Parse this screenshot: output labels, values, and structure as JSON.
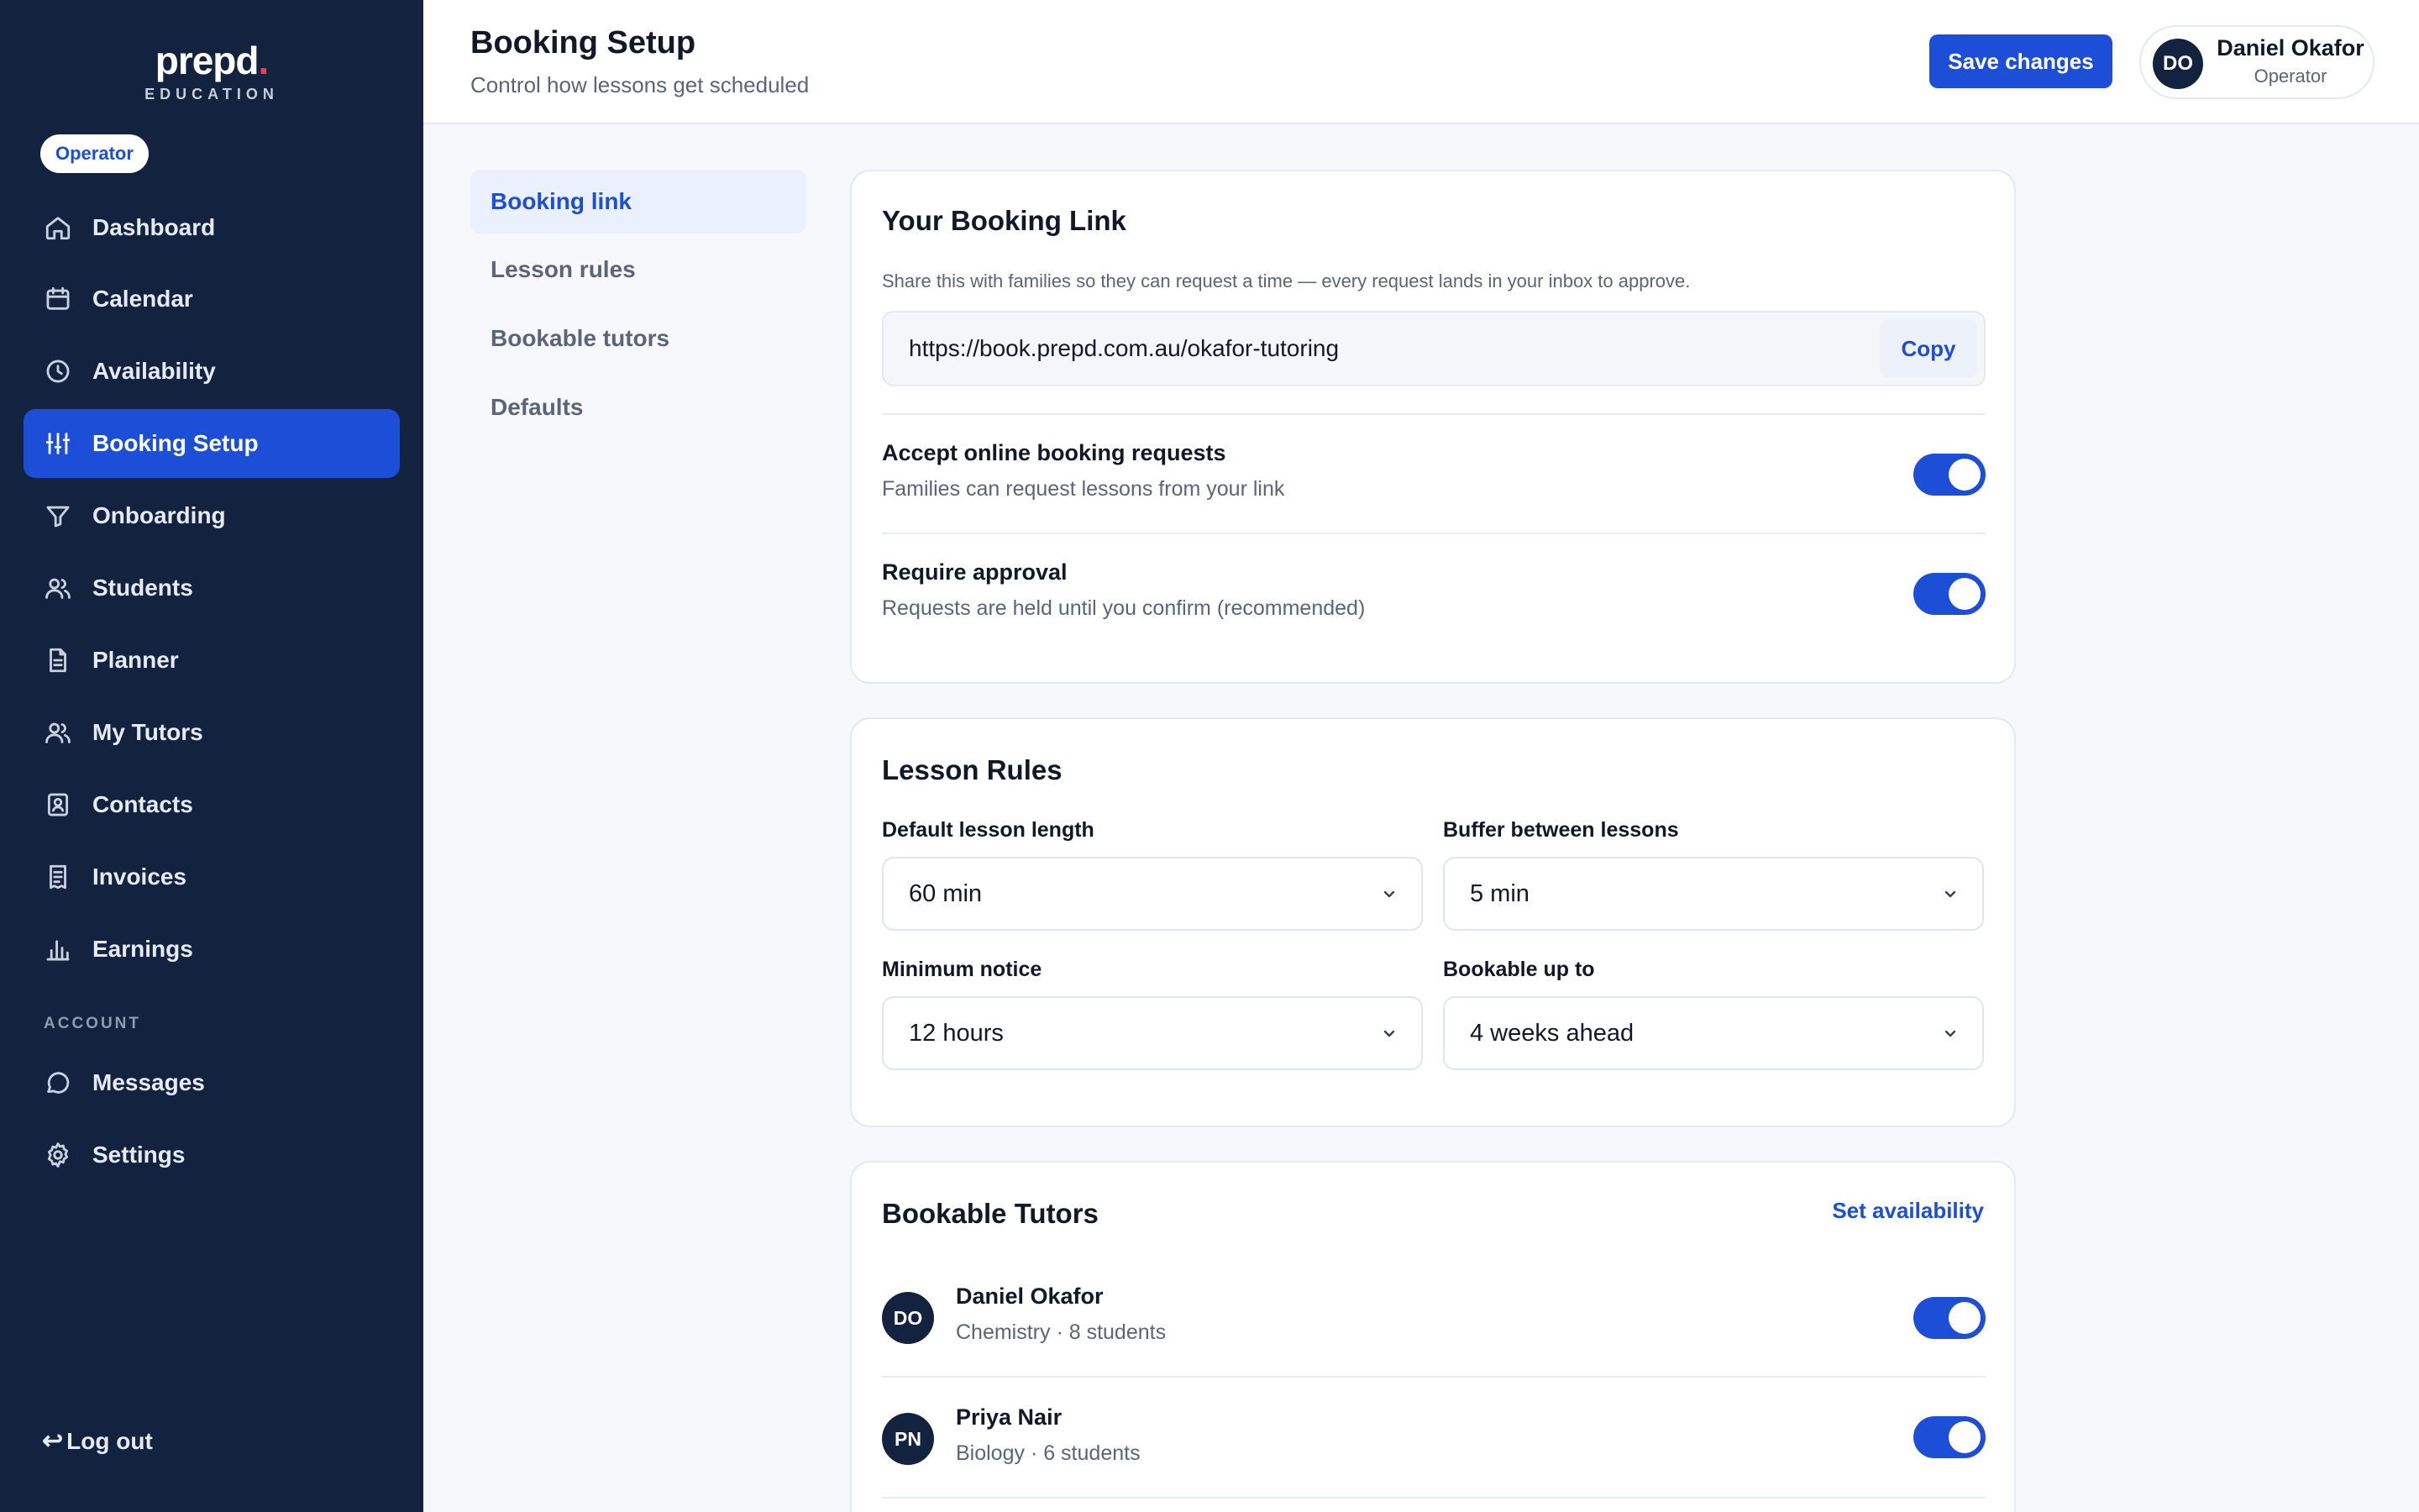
{
  "brand": {
    "name": "prepd",
    "dot": ".",
    "subtitle": "EDUCATION"
  },
  "role_badge": "Operator",
  "nav": {
    "items": [
      {
        "label": "Dashboard",
        "icon": "home-icon"
      },
      {
        "label": "Calendar",
        "icon": "calendar-icon"
      },
      {
        "label": "Availability",
        "icon": "clock-icon"
      },
      {
        "label": "Booking Setup",
        "icon": "sliders-icon",
        "active": true
      },
      {
        "label": "Onboarding",
        "icon": "filter-icon"
      },
      {
        "label": "Students",
        "icon": "users-icon"
      },
      {
        "label": "Planner",
        "icon": "document-icon"
      },
      {
        "label": "My Tutors",
        "icon": "users-icon"
      },
      {
        "label": "Contacts",
        "icon": "contact-card-icon"
      },
      {
        "label": "Invoices",
        "icon": "receipt-icon"
      },
      {
        "label": "Earnings",
        "icon": "bar-chart-icon"
      }
    ],
    "account_heading": "ACCOUNT",
    "account_items": [
      {
        "label": "Messages",
        "icon": "chat-bubble-icon"
      },
      {
        "label": "Settings",
        "icon": "gear-icon"
      }
    ],
    "logout_label": "Log out",
    "logout_icon": "↩"
  },
  "header": {
    "title": "Booking Setup",
    "subtitle": "Control how lessons get scheduled",
    "save_label": "Save changes",
    "user": {
      "initials": "DO",
      "name": "Daniel Okafor",
      "role": "Operator"
    }
  },
  "subnav": [
    {
      "label": "Booking link",
      "active": true
    },
    {
      "label": "Lesson rules"
    },
    {
      "label": "Bookable tutors"
    },
    {
      "label": "Defaults"
    }
  ],
  "booking_link": {
    "title": "Your Booking Link",
    "description": "Share this with families so they can request a time — every request lands in your inbox to approve.",
    "url": "https://book.prepd.com.au/okafor-tutoring",
    "copy_label": "Copy",
    "accept": {
      "title": "Accept online booking requests",
      "subtitle": "Families can request lessons from your link",
      "enabled": true
    },
    "approval": {
      "title": "Require approval",
      "subtitle": "Requests are held until you confirm (recommended)",
      "enabled": true
    }
  },
  "lesson_rules": {
    "title": "Lesson Rules",
    "default_length": {
      "label": "Default lesson length",
      "value": "60 min"
    },
    "buffer": {
      "label": "Buffer between lessons",
      "value": "5 min"
    },
    "min_notice": {
      "label": "Minimum notice",
      "value": "12 hours"
    },
    "bookable_up_to": {
      "label": "Bookable up to",
      "value": "4 weeks ahead"
    }
  },
  "bookable_tutors": {
    "title": "Bookable Tutors",
    "action_label": "Set availability",
    "tutors": [
      {
        "initials": "DO",
        "name": "Daniel Okafor",
        "meta": "Chemistry · 8 students",
        "enabled": true
      },
      {
        "initials": "PN",
        "name": "Priya Nair",
        "meta": "Biology · 6 students",
        "enabled": true
      }
    ]
  },
  "colors": {
    "sidebar_bg": "#13223f",
    "accent": "#1d4ed8",
    "brand_dot": "#ef3b4f"
  }
}
